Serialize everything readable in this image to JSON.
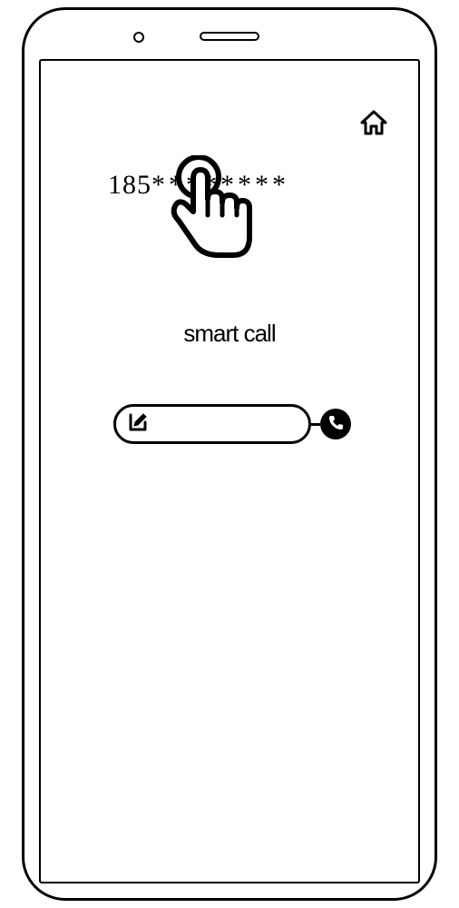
{
  "phone_number": "185",
  "phone_number_mask": "********",
  "app_title": "smart call",
  "input_value": ""
}
